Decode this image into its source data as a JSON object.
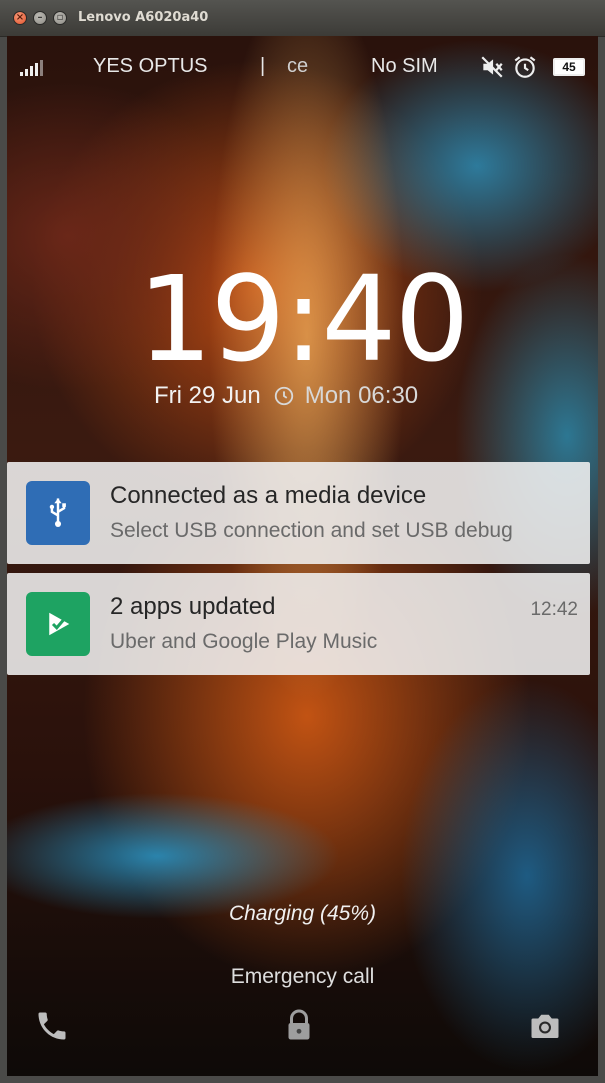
{
  "window": {
    "title": "Lenovo A6020a40",
    "close_glyph": "×",
    "minimize_glyph": "–",
    "maximize_glyph": "▫"
  },
  "statusbar": {
    "carrier1": "YES OPTUS",
    "separator": "|",
    "carrier2_fragment": "ce",
    "sim_status": "No SIM",
    "battery_level": "45",
    "icons": [
      "signal-icon",
      "mute-icon",
      "alarm-icon",
      "battery-icon"
    ]
  },
  "lockscreen": {
    "time": "19:40",
    "date": "Fri 29 Jun",
    "next_alarm": "Mon 06:30"
  },
  "notifications": [
    {
      "title": "Connected as a media device",
      "body": "Select USB connection and set USB debug",
      "time": "",
      "icon": "usb-icon",
      "icon_color": "#2f6db5"
    },
    {
      "title": "2 apps updated",
      "body": "Uber and Google Play Music",
      "time": "12:42",
      "icon": "play-store-update-icon",
      "icon_color": "#1ea362"
    }
  ],
  "footer": {
    "charging": "Charging (45%)",
    "emergency": "Emergency call",
    "icons": [
      "phone-icon",
      "lock-icon",
      "camera-icon"
    ]
  }
}
